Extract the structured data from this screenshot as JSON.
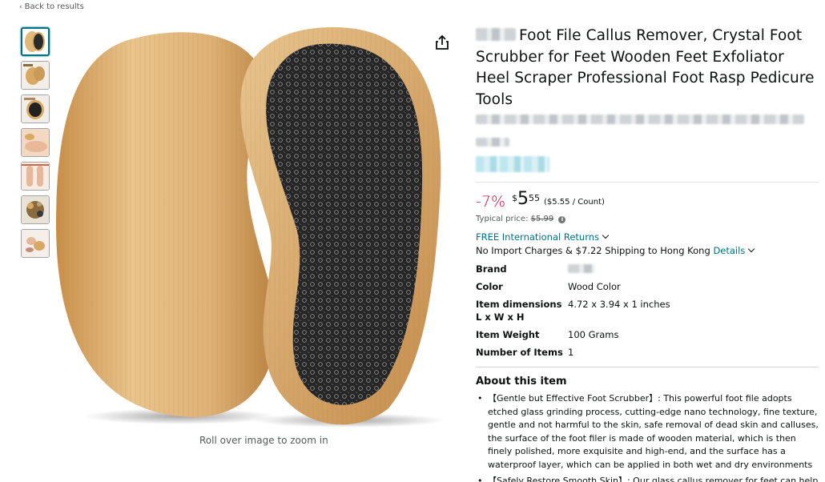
{
  "nav": {
    "back_label": "Back to results",
    "back_icon": "chevron-left-icon"
  },
  "gallery": {
    "thumbnails": [
      {
        "name": "thumb-1",
        "active": true
      },
      {
        "name": "thumb-2",
        "active": false
      },
      {
        "name": "thumb-3",
        "active": false
      },
      {
        "name": "thumb-4",
        "active": false
      },
      {
        "name": "thumb-5",
        "active": false
      },
      {
        "name": "thumb-6",
        "active": false
      },
      {
        "name": "thumb-7",
        "active": false
      }
    ],
    "zoom_hint": "Roll over image to zoom in",
    "share_icon": "share-icon"
  },
  "product": {
    "title": "Foot File Callus Remover, Crystal Foot Scrubber for Feet Wooden Feet Exfoliator Heel Scraper Professional Foot Rasp Pedicure Tools"
  },
  "pricing": {
    "discount": "-7%",
    "currency": "$",
    "whole": "5",
    "fraction": "55",
    "unit_price": "($5.55 / Count)",
    "typical_label": "Typical price:",
    "typical_price": "$5.99",
    "discount_color": "#cc0c39"
  },
  "shipping": {
    "returns": "FREE International Returns",
    "import_text": "No Import Charges & $7.22 Shipping to Hong Kong",
    "details_link": "Details",
    "link_color": "#007185"
  },
  "specs": [
    {
      "key": "Brand",
      "value": ""
    },
    {
      "key": "Color",
      "value": "Wood Color"
    },
    {
      "key": "Item dimensions L x W x H",
      "value": "4.72 x 3.94 x 1 inches"
    },
    {
      "key": "Item Weight",
      "value": "100 Grams"
    },
    {
      "key": "Number of Items",
      "value": "1"
    }
  ],
  "about": {
    "title": "About this item",
    "bullets": [
      "【Gentle but Effective Foot Scrubber】: This powerful foot file adopts etched glass grinding process, cutting-edge nano technology, fine texture, gentle and not harmful to the skin, safe removal of dead skin and calluses, the surface of the foot filer is made of wooden material, which is then finely polished, more exquisite and high-end, and the surface has a waterproof layer, which can be applied in both wet and dry environments",
      "【Safely Restore Smooth Skin】: Our glass callus remover for feet can help you solve the problems of thick calluses, cracked soles, dead skin"
    ]
  }
}
